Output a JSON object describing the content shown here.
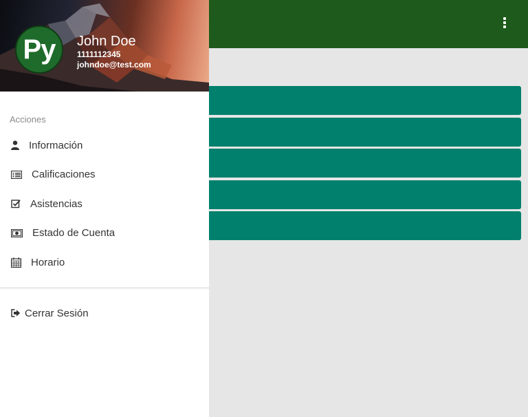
{
  "user": {
    "avatar_text": "Py",
    "name": "John Doe",
    "id": "1111112345",
    "email": "johndoe@test.com"
  },
  "drawer": {
    "section_label": "Acciones",
    "items": [
      {
        "label": "Información",
        "icon": "user-icon"
      },
      {
        "label": "Calificaciones",
        "icon": "list-icon"
      },
      {
        "label": "Asistencias",
        "icon": "check-square-icon"
      },
      {
        "label": "Estado de Cuenta",
        "icon": "money-icon"
      },
      {
        "label": "Horario",
        "icon": "calendar-icon"
      }
    ],
    "logout_label": "Cerrar Sesión",
    "logout_icon": "sign-out-icon"
  },
  "appbar": {
    "color": "#1e5a1b",
    "menu_icon": "more-vertical-icon"
  },
  "content": {
    "bar_color": "#00806d",
    "bar_count": 5
  }
}
